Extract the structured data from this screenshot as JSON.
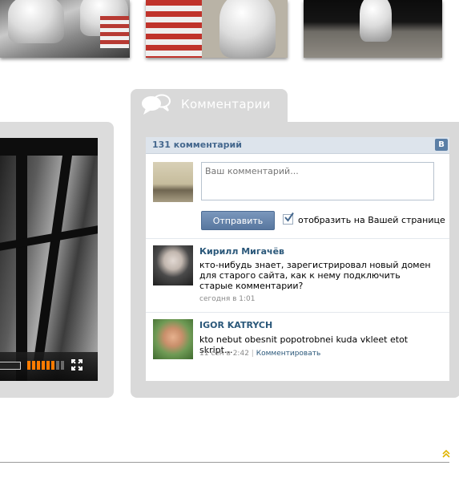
{
  "gallery": {
    "thumbs": [
      "astronaut-with-flag-photo",
      "flag-and-astronaut-photo",
      "astronaut-on-moon-photo"
    ]
  },
  "video": {
    "volume_level": 0.75
  },
  "comments_panel": {
    "tab_title": "Комментарии"
  },
  "vk_widget": {
    "count_label": "131 комментарий",
    "logo_letter": "B",
    "input_placeholder": "Ваш комментарий...",
    "submit_label": "Отправить",
    "wall_checkbox_checked": true,
    "wall_label": "отобразить на Вашей странице",
    "comments": [
      {
        "author": "Кирилл Мигачёв",
        "text": "кто-нибудь знает, зарегистрировал новый домен для старого сайта, как к  нему подключить старые комментарии?",
        "time": "сегодня в 1:01"
      },
      {
        "author": "IGOR KATRYCH",
        "text": "kto nebut obesnit popotrobnei kuda vkleet etot skript...",
        "time": "11 сен в 2:42",
        "separator": "|",
        "reply_label": "Комментировать"
      }
    ]
  },
  "colors": {
    "panel_gray": "#d9d9d9",
    "vk_header": "#dde4ec",
    "vk_link": "#2b587a",
    "vk_button": "#5b7fa6",
    "volume_orange": "#ff7b00"
  }
}
